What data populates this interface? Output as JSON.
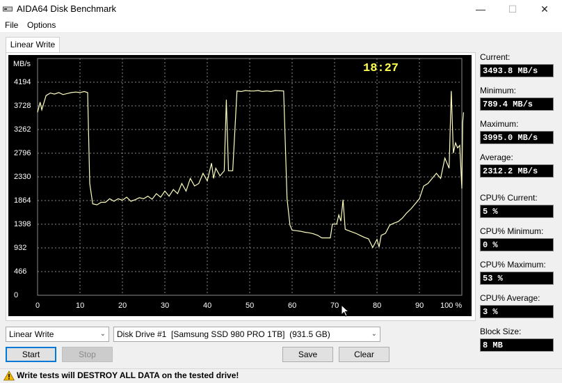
{
  "window": {
    "title": "AIDA64 Disk Benchmark",
    "minimize": "—",
    "maximize": "☐",
    "close": "✕"
  },
  "menu": {
    "items": [
      "File",
      "Options"
    ]
  },
  "tab": {
    "label": "Linear Write"
  },
  "chart": {
    "clock": "18:27",
    "unit": "MB/s",
    "line_color": "#ffffc0",
    "grid_color": "#8a8a8a",
    "y_tick_labels": [
      "4194",
      "3728",
      "3262",
      "2796",
      "2330",
      "1864",
      "1398",
      "932",
      "466",
      "0"
    ],
    "x_tick_labels": [
      "0",
      "10",
      "20",
      "30",
      "40",
      "50",
      "60",
      "70",
      "80",
      "90",
      "100 %"
    ]
  },
  "chart_data": {
    "type": "line",
    "title": "",
    "xlabel": "",
    "ylabel": "MB/s",
    "xlim": [
      0,
      100
    ],
    "ylim": [
      0,
      4660
    ],
    "x_ticks": [
      0,
      10,
      20,
      30,
      40,
      50,
      60,
      70,
      80,
      90,
      100
    ],
    "y_ticks": [
      0,
      466,
      932,
      1398,
      1864,
      2330,
      2796,
      3262,
      3728,
      4194
    ],
    "grid": true,
    "series": [
      {
        "values": [
          [
            0,
            3600
          ],
          [
            0.6,
            3800
          ],
          [
            1,
            3650
          ],
          [
            2,
            3930
          ],
          [
            3,
            3980
          ],
          [
            4,
            3960
          ],
          [
            5,
            3990
          ],
          [
            6,
            3950
          ],
          [
            7,
            3970
          ],
          [
            8,
            3990
          ],
          [
            9,
            4000
          ],
          [
            10,
            3990
          ],
          [
            11,
            4010
          ],
          [
            11.8,
            3990
          ],
          [
            12.3,
            2200
          ],
          [
            13,
            1800
          ],
          [
            14,
            1780
          ],
          [
            15,
            1830
          ],
          [
            16,
            1830
          ],
          [
            17,
            1900
          ],
          [
            18,
            1850
          ],
          [
            19,
            1900
          ],
          [
            20,
            1870
          ],
          [
            21,
            1930
          ],
          [
            22,
            1850
          ],
          [
            23,
            1880
          ],
          [
            24,
            1920
          ],
          [
            25,
            1900
          ],
          [
            26,
            1950
          ],
          [
            27,
            1890
          ],
          [
            28,
            2000
          ],
          [
            29,
            1930
          ],
          [
            30,
            2050
          ],
          [
            31,
            1950
          ],
          [
            32,
            2080
          ],
          [
            33,
            2000
          ],
          [
            34,
            2200
          ],
          [
            35,
            2050
          ],
          [
            36,
            2300
          ],
          [
            37,
            2150
          ],
          [
            38,
            2200
          ],
          [
            39,
            2400
          ],
          [
            40,
            2250
          ],
          [
            41,
            2600
          ],
          [
            41.5,
            2300
          ],
          [
            42,
            2500
          ],
          [
            43,
            2350
          ],
          [
            44,
            2450
          ],
          [
            44.5,
            3850
          ],
          [
            45,
            2450
          ],
          [
            46,
            2450
          ],
          [
            47,
            4020
          ],
          [
            48,
            4010
          ],
          [
            49,
            4030
          ],
          [
            50,
            4020
          ],
          [
            51,
            4020
          ],
          [
            52,
            4030
          ],
          [
            53,
            4010
          ],
          [
            54,
            4020
          ],
          [
            55,
            4010
          ],
          [
            56,
            4030
          ],
          [
            58,
            4020
          ],
          [
            58.8,
            1900
          ],
          [
            59.5,
            1380
          ],
          [
            60,
            1280
          ],
          [
            61,
            1270
          ],
          [
            62,
            1260
          ],
          [
            63,
            1240
          ],
          [
            64,
            1230
          ],
          [
            65,
            1210
          ],
          [
            66,
            1180
          ],
          [
            67,
            1130
          ],
          [
            68,
            1130
          ],
          [
            69,
            1130
          ],
          [
            69.5,
            1400
          ],
          [
            70.5,
            1400
          ],
          [
            71,
            1580
          ],
          [
            71.5,
            1460
          ],
          [
            72,
            1880
          ],
          [
            72.5,
            1300
          ],
          [
            73,
            1280
          ],
          [
            74,
            1250
          ],
          [
            75,
            1220
          ],
          [
            76,
            1180
          ],
          [
            77,
            1140
          ],
          [
            78,
            1110
          ],
          [
            79,
            940
          ],
          [
            80,
            1100
          ],
          [
            80.5,
            950
          ],
          [
            81,
            1180
          ],
          [
            82,
            1220
          ],
          [
            83,
            1380
          ],
          [
            84,
            1420
          ],
          [
            85,
            1450
          ],
          [
            86,
            1520
          ],
          [
            87,
            1620
          ],
          [
            88,
            1700
          ],
          [
            89,
            1800
          ],
          [
            90,
            1900
          ],
          [
            91,
            2150
          ],
          [
            92,
            2200
          ],
          [
            93,
            2300
          ],
          [
            94,
            2400
          ],
          [
            95,
            2300
          ],
          [
            96,
            2700
          ],
          [
            97,
            2500
          ],
          [
            97.5,
            4020
          ],
          [
            98,
            2800
          ],
          [
            98.5,
            3000
          ],
          [
            99,
            2900
          ],
          [
            99.5,
            2950
          ],
          [
            100,
            2100
          ],
          [
            100.2,
            3400
          ],
          [
            100.4,
            3600
          ]
        ]
      }
    ]
  },
  "stats": [
    {
      "label": "Current:",
      "value": "3493.8 MB/s"
    },
    {
      "label": "Minimum:",
      "value": "789.4 MB/s"
    },
    {
      "label": "Maximum:",
      "value": "3995.0 MB/s"
    },
    {
      "label": "Average:",
      "value": "2312.2 MB/s"
    },
    {
      "label": "CPU% Current:",
      "value": "5 %"
    },
    {
      "label": "CPU% Minimum:",
      "value": "0 %"
    },
    {
      "label": "CPU% Maximum:",
      "value": "53 %"
    },
    {
      "label": "CPU% Average:",
      "value": "3 %"
    },
    {
      "label": "Block Size:",
      "value": "8 MB"
    }
  ],
  "controls": {
    "test_select": "Linear Write",
    "drive_select": "Disk Drive #1  [Samsung SSD 980 PRO 1TB]  (931.5 GB)",
    "start": "Start",
    "stop": "Stop",
    "save": "Save",
    "clear": "Clear"
  },
  "status": {
    "warning": "Write tests will DESTROY ALL DATA on the tested drive!",
    "warning_color": "#f2b500"
  }
}
